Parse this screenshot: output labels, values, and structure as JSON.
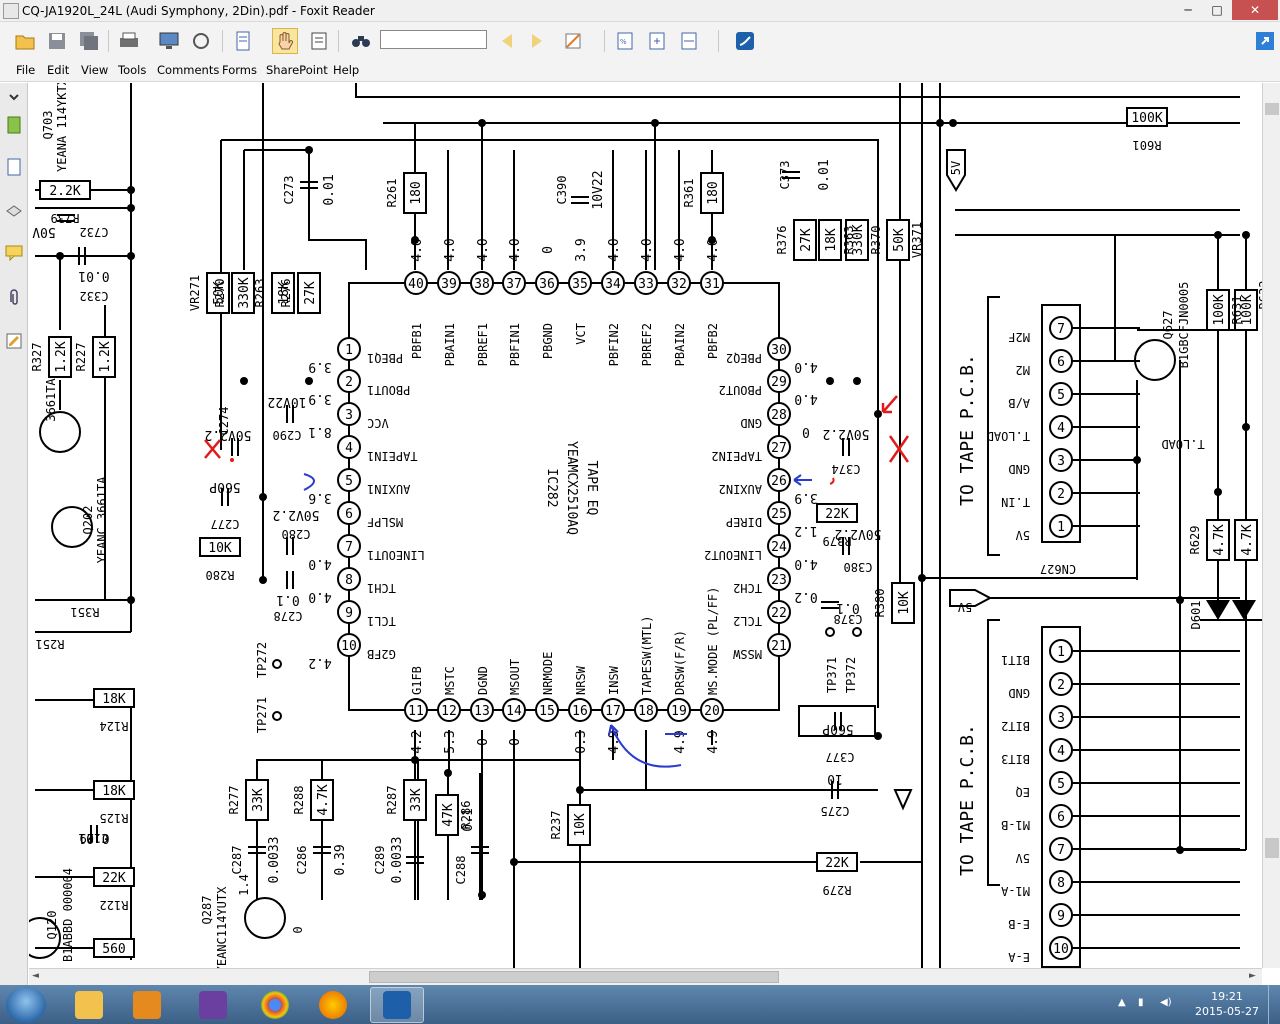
{
  "window": {
    "title": "CQ-JA1920L_24L (Audi Symphony, 2Din).pdf - Foxit Reader",
    "minimize": "─",
    "maximize": "□",
    "close": "✕"
  },
  "menu": [
    "File",
    "Edit",
    "View",
    "Tools",
    "Comments",
    "Forms",
    "SharePoint",
    "Help"
  ],
  "search": {
    "value": "",
    "placeholder": ""
  },
  "taskbar": {
    "time": "19:21",
    "date": "2015-05-27"
  },
  "schematic": {
    "ic_name": "IC282",
    "ic_part": "YEAMCX2510AQ",
    "ic_func": "TAPE EQ",
    "tape_pcb_label": "TO TAPE P.C.B.",
    "connector_cn627": "CN627",
    "cn627_pins": [
      "M2F",
      "M2",
      "A/B",
      "T.LOAD",
      "GND",
      "T.IN",
      "5V"
    ],
    "lower_connector_pins": [
      "BIT1",
      "GND",
      "BIT2",
      "BIT3",
      "EQ",
      "M1-B",
      "5V",
      "M1-A",
      "E-B",
      "E-A"
    ],
    "pins_top": [
      {
        "num": "40",
        "name": "PBFB1",
        "v": "4.0"
      },
      {
        "num": "39",
        "name": "PBAIN1",
        "v": "4.0"
      },
      {
        "num": "38",
        "name": "PBREF1",
        "v": "4.0"
      },
      {
        "num": "37",
        "name": "PBFIN1",
        "v": "4.0"
      },
      {
        "num": "36",
        "name": "PBGND",
        "v": "0"
      },
      {
        "num": "35",
        "name": "VCT",
        "v": "3.9"
      },
      {
        "num": "34",
        "name": "PBFIN2",
        "v": "4.0"
      },
      {
        "num": "33",
        "name": "PBREF2",
        "v": "4.0"
      },
      {
        "num": "32",
        "name": "PBAIN2",
        "v": "4.0"
      },
      {
        "num": "31",
        "name": "PBFB2",
        "v": "4.0"
      }
    ],
    "pins_left": [
      {
        "num": "1",
        "name": "PBEQ1",
        "v": "3.9"
      },
      {
        "num": "2",
        "name": "PBOUT1",
        "v": "3.9"
      },
      {
        "num": "3",
        "name": "VCC",
        "v": "8.1"
      },
      {
        "num": "4",
        "name": "TAPEIN1",
        "v": ""
      },
      {
        "num": "5",
        "name": "AUXIN1",
        "v": "3.6"
      },
      {
        "num": "6",
        "name": "MSLPF",
        "v": ""
      },
      {
        "num": "7",
        "name": "LINEOUT1",
        "v": "4.0"
      },
      {
        "num": "8",
        "name": "TCH1",
        "v": "4.0"
      },
      {
        "num": "9",
        "name": "TCL1",
        "v": ""
      },
      {
        "num": "10",
        "name": "G2FB",
        "v": "4.2"
      }
    ],
    "pins_right": [
      {
        "num": "30",
        "name": "PBEQ2",
        "v": "4.0"
      },
      {
        "num": "29",
        "name": "PBOUT2",
        "v": "4.0"
      },
      {
        "num": "28",
        "name": "GND",
        "v": "0"
      },
      {
        "num": "27",
        "name": "TAPEIN2",
        "v": ""
      },
      {
        "num": "26",
        "name": "AUXIN2",
        "v": "3.9"
      },
      {
        "num": "25",
        "name": "DIREP",
        "v": "1.2"
      },
      {
        "num": "24",
        "name": "LINEOUT2",
        "v": "4.0"
      },
      {
        "num": "23",
        "name": "TCH2",
        "v": "0.2"
      },
      {
        "num": "22",
        "name": "TCL2",
        "v": ""
      },
      {
        "num": "21",
        "name": "MSSW",
        "v": ""
      }
    ],
    "pins_bottom": [
      {
        "num": "11",
        "name": "G1FB",
        "v": "4.2"
      },
      {
        "num": "12",
        "name": "MSTC",
        "v": "5.3"
      },
      {
        "num": "13",
        "name": "DGND",
        "v": "0"
      },
      {
        "num": "14",
        "name": "MSOUT",
        "v": "0"
      },
      {
        "num": "15",
        "name": "NRMODE",
        "v": ""
      },
      {
        "num": "16",
        "name": "NRSW",
        "v": "0.3"
      },
      {
        "num": "17",
        "name": "INSW",
        "v": "4.9"
      },
      {
        "num": "18",
        "name": "TAPESW(MTL)",
        "v": ""
      },
      {
        "num": "19",
        "name": "DRSW(F/R)",
        "v": "4.9"
      },
      {
        "num": "20",
        "name": "MS.MODE (PL/FF)",
        "v": "4.9"
      }
    ],
    "components": [
      {
        "ref": "R261",
        "val": "180"
      },
      {
        "ref": "R361",
        "val": "180"
      },
      {
        "ref": "C390",
        "val": "10V22"
      },
      {
        "ref": "C273",
        "val": "0.01"
      },
      {
        "ref": "C373",
        "val": "0.01"
      },
      {
        "ref": "R270",
        "val": "330K"
      },
      {
        "ref": "VR271",
        "val": "50K"
      },
      {
        "ref": "R263",
        "val": "18K"
      },
      {
        "ref": "R276",
        "val": "27K"
      },
      {
        "ref": "R376",
        "val": "27K"
      },
      {
        "ref": "R363",
        "val": "18K"
      },
      {
        "ref": "R370",
        "val": "330K"
      },
      {
        "ref": "VR371",
        "val": "50K"
      },
      {
        "ref": "C290",
        "val": "10V22"
      },
      {
        "ref": "C274",
        "val": "50V2.2"
      },
      {
        "ref": "C374",
        "val": "50V2.2"
      },
      {
        "ref": "C277",
        "val": "560P"
      },
      {
        "ref": "C280",
        "val": "50V2.2"
      },
      {
        "ref": "C380",
        "val": "50V2.2"
      },
      {
        "ref": "R280",
        "val": "10K"
      },
      {
        "ref": "R379",
        "val": "22K"
      },
      {
        "ref": "C278",
        "val": "0.1"
      },
      {
        "ref": "C378",
        "val": "0.1"
      },
      {
        "ref": "R380",
        "val": "10K"
      },
      {
        "ref": "C377",
        "val": "560P"
      },
      {
        "ref": "C275",
        "val": "10"
      },
      {
        "ref": "R279",
        "val": "22K"
      },
      {
        "ref": "R237",
        "val": "10K"
      },
      {
        "ref": "R277",
        "val": "33K"
      },
      {
        "ref": "R288",
        "val": "4.7K"
      },
      {
        "ref": "R287",
        "val": "33K"
      },
      {
        "ref": "R286",
        "val": "47K"
      },
      {
        "ref": "C287",
        "val": "0.0033"
      },
      {
        "ref": "C286",
        "val": "0.39"
      },
      {
        "ref": "C289",
        "val": "0.0033"
      },
      {
        "ref": "C288",
        "val": "0.1"
      },
      {
        "ref": "R601",
        "val": "100K"
      },
      {
        "ref": "R631",
        "val": "100K"
      },
      {
        "ref": "R629",
        "val": "4.7K"
      },
      {
        "ref": "R739",
        "val": "2.2K"
      },
      {
        "ref": "C732",
        "val": "50V"
      },
      {
        "ref": "C332",
        "val": "0.01"
      },
      {
        "ref": "R327",
        "val": "1.2K"
      },
      {
        "ref": "R227",
        "val": "1.2K"
      },
      {
        "ref": "R124",
        "val": "18K"
      },
      {
        "ref": "R125",
        "val": "18K"
      },
      {
        "ref": "C129",
        "val": "0.01"
      },
      {
        "ref": "R122",
        "val": "22K"
      },
      {
        "ref": "R120",
        "val": "560"
      }
    ],
    "transistors": [
      {
        "ref": "Q202",
        "part": "YEANC 3661TA"
      },
      {
        "ref": "Q287",
        "part": "YEANC114YUTX"
      },
      {
        "ref": "Q120",
        "part": "B1ABBD 000004"
      },
      {
        "ref": "Q627",
        "part": "B1GBCFJN0005"
      },
      {
        "ref": "Q703",
        "part": "YEANA 114YKTX"
      }
    ],
    "misc": {
      "d601": "D601",
      "tp271": "TP271",
      "tp272": "TP272",
      "tp371": "TP371",
      "tp372": "TP372",
      "r351": "R351",
      "r251": "R251",
      "net_5v": "5V",
      "t_load": "T.LOAD",
      "r632": "R632",
      "lbl_3661ta": "3661TA",
      "lbl_0": "0",
      "lbl_1_4": "1.4"
    }
  },
  "colors": {
    "annotation_red": "#e01b1b",
    "annotation_blue": "#2a3bd0",
    "ink": "#000000"
  }
}
